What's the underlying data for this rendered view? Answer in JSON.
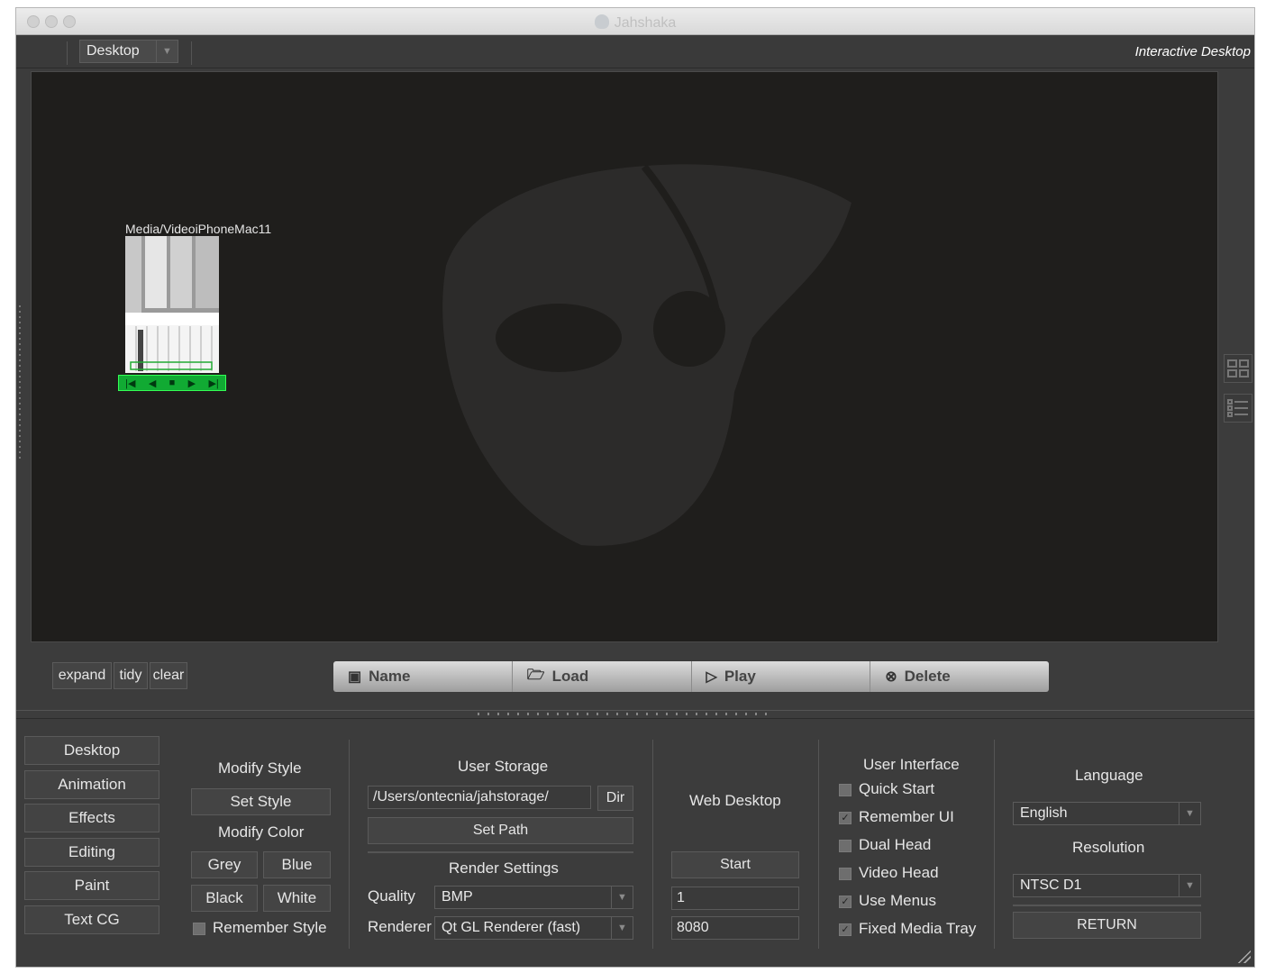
{
  "window": {
    "title": "Jahshaka"
  },
  "topbar": {
    "desktop_combo": "Desktop",
    "mode_title": "Interactive Desktop"
  },
  "desktop": {
    "clip_title": "Media/VideoiPhoneMac11",
    "clip_controls": [
      "|◀",
      "◀",
      "■",
      "▶",
      "▶|"
    ]
  },
  "layout_buttons": [
    "expand",
    "tidy",
    "clear"
  ],
  "toolbar": [
    {
      "label": "Name",
      "icon": "image-icon"
    },
    {
      "label": "Load",
      "icon": "folder-open-icon"
    },
    {
      "label": "Play",
      "icon": "play-icon"
    },
    {
      "label": "Delete",
      "icon": "delete-icon"
    }
  ],
  "nav": [
    "Desktop",
    "Animation",
    "Effects",
    "Editing",
    "Paint",
    "Text CG"
  ],
  "style": {
    "modify_style": "Modify Style",
    "set_style": "Set Style",
    "modify_color": "Modify Color",
    "grey": "Grey",
    "blue": "Blue",
    "black": "Black",
    "white": "White",
    "remember_style": "Remember Style",
    "remember_style_checked": false
  },
  "storage": {
    "title": "User Storage",
    "path": "/Users/ontecnia/jahstorage/",
    "dir": "Dir",
    "set_path": "Set Path",
    "render_settings": "Render Settings",
    "quality_label": "Quality",
    "quality": "BMP",
    "renderer_label": "Renderer",
    "renderer": "Qt GL Renderer (fast)"
  },
  "web": {
    "title": "Web Desktop",
    "start": "Start",
    "field1": "1",
    "port": "8080"
  },
  "ui": {
    "title": "User Interface",
    "options": [
      {
        "label": "Quick Start",
        "checked": false
      },
      {
        "label": "Remember UI",
        "checked": true
      },
      {
        "label": "Dual Head",
        "checked": false
      },
      {
        "label": "Video Head",
        "checked": false
      },
      {
        "label": "Use Menus",
        "checked": true
      },
      {
        "label": "Fixed Media Tray",
        "checked": true
      }
    ]
  },
  "lang": {
    "language_label": "Language",
    "language": "English",
    "resolution_label": "Resolution",
    "resolution": "NTSC D1",
    "return": "RETURN"
  }
}
